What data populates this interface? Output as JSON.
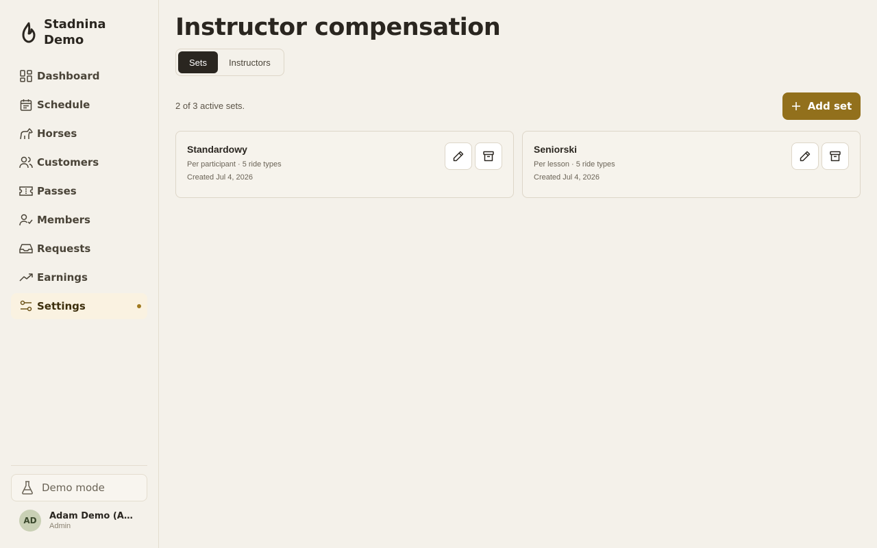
{
  "brand": {
    "name": "Stadnina Demo"
  },
  "nav": {
    "items": [
      {
        "label": "Dashboard",
        "icon": "dashboard-icon"
      },
      {
        "label": "Schedule",
        "icon": "calendar-icon"
      },
      {
        "label": "Horses",
        "icon": "horse-icon"
      },
      {
        "label": "Customers",
        "icon": "users-icon"
      },
      {
        "label": "Passes",
        "icon": "ticket-icon"
      },
      {
        "label": "Members",
        "icon": "user-check-icon"
      },
      {
        "label": "Requests",
        "icon": "inbox-icon"
      },
      {
        "label": "Earnings",
        "icon": "trending-up-icon"
      },
      {
        "label": "Settings",
        "icon": "settings-sliders-icon",
        "active": true
      }
    ]
  },
  "demo_mode": {
    "label": "Demo mode",
    "icon": "flask-icon"
  },
  "user": {
    "initials": "AD",
    "name": "Adam Demo (Admin)",
    "role": "Admin"
  },
  "page": {
    "title": "Instructor compensation",
    "tabs": [
      {
        "label": "Sets",
        "active": true
      },
      {
        "label": "Instructors",
        "active": false
      }
    ],
    "summary": "2 of 3 active sets.",
    "add_button_label": "Add set"
  },
  "cards": [
    {
      "title": "Standardowy",
      "meta": "Per participant · 5 ride types",
      "created": "Created Jul 4, 2026"
    },
    {
      "title": "Seniorski",
      "meta": "Per lesson · 5 ride types",
      "created": "Created Jul 4, 2026"
    }
  ],
  "colors": {
    "background": "#f4f1ea",
    "accent": "#92701c",
    "active_nav_bg": "#faf2e1",
    "active_tab_bg": "#2a2620"
  }
}
